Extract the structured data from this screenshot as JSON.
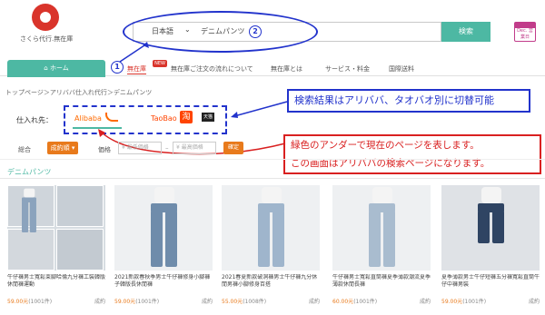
{
  "header": {
    "logo_text": "さくら代行.無在庫",
    "search": {
      "language": "日本語",
      "value": "デニムパンツ",
      "button": "検索"
    },
    "calendar": "Dec.\n営業日"
  },
  "annotations": {
    "num1": "1",
    "num2": "2",
    "callout_blue": "検索結果はアリババ、タオバオ別に切替可能",
    "callout_red_line1": "緑色のアンダーで現在のページを表します。",
    "callout_red_line2": "この画面はアリババの検索ページになります。"
  },
  "nav": {
    "home": "ホーム",
    "items": [
      "無在庫",
      "無在庫ご注文の流れについて",
      "無在庫とは",
      "サービス・料金",
      "国際送料"
    ],
    "new_badge": "NEW"
  },
  "breadcrumb": "トップページ＞アリババ仕入れ代行＞デニムパンツ",
  "source": {
    "label": "仕入れ先：",
    "alibaba": "Alibaba",
    "taobao": "TaoBao",
    "tao_logo": "淘",
    "tmall_logo": "天猫"
  },
  "filters": {
    "overall": "総合",
    "sales_order": "成約順 ▾",
    "price": "価格",
    "min_placeholder": "¥ 最低価格",
    "max_placeholder": "¥ 最高価格",
    "confirm": "確定"
  },
  "section_title": "デニムパンツ",
  "products": [
    {
      "title": "牛仔褲男士寬鬆束腳哈倫九分褲工裝韓版休閒褲運動",
      "price": "59.00元",
      "sales": "(1001件)",
      "orders": "成約"
    },
    {
      "title": "2021新款春秋季男士牛仔褲修身小腳褲子韓版長休閒褲",
      "price": "59.00元",
      "sales": "(1001件)",
      "orders": "成約"
    },
    {
      "title": "2021春夏新款破洞褲男士牛仔褲九分休閒男褲小腳修身百搭",
      "price": "55.00元",
      "sales": "(1008件)",
      "orders": "成約"
    },
    {
      "title": "牛仔褲男士寬鬆直筒褲夏季薄款潮流夏季薄款休閒長褲",
      "price": "60.00元",
      "sales": "(1001件)",
      "orders": "成約"
    },
    {
      "title": "夏季薄款男士牛仔短褲五分褲寬鬆直筒牛仔中褲男裝",
      "price": "59.00元",
      "sales": "(1001件)",
      "orders": "成約"
    }
  ],
  "colors": {
    "accent": "#4db8a3",
    "orange": "#e87a1c",
    "annotation_blue": "#2233cc",
    "annotation_red": "#d92020"
  }
}
